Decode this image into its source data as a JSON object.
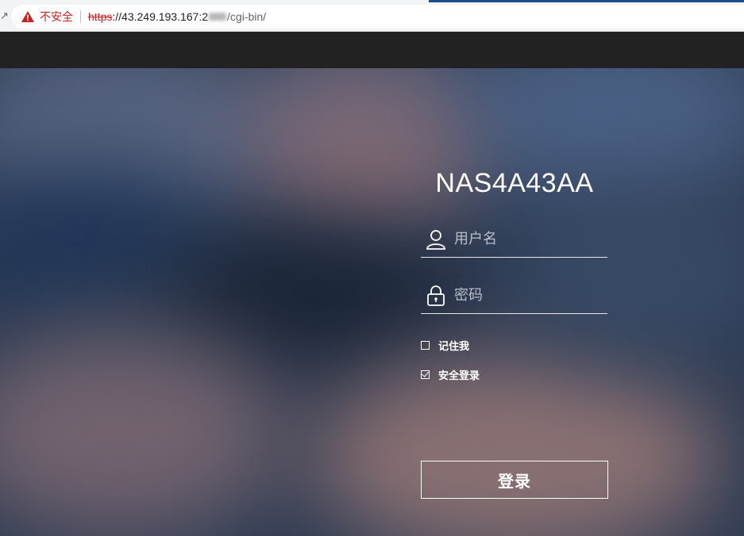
{
  "browser": {
    "security_label": "不安全",
    "url": {
      "scheme": "https",
      "host": "://43.249.193.167:",
      "port_visible": "2",
      "path": "/cgi-bin/"
    }
  },
  "login": {
    "device_name": "NAS4A43AA",
    "username_placeholder": "用户名",
    "password_placeholder": "密码",
    "remember_me_label": "记住我",
    "remember_me_checked": false,
    "secure_login_label": "安全登录",
    "secure_login_checked": true,
    "submit_label": "登录"
  },
  "colors": {
    "warning": "#c5221f",
    "header_bar": "#222222"
  }
}
